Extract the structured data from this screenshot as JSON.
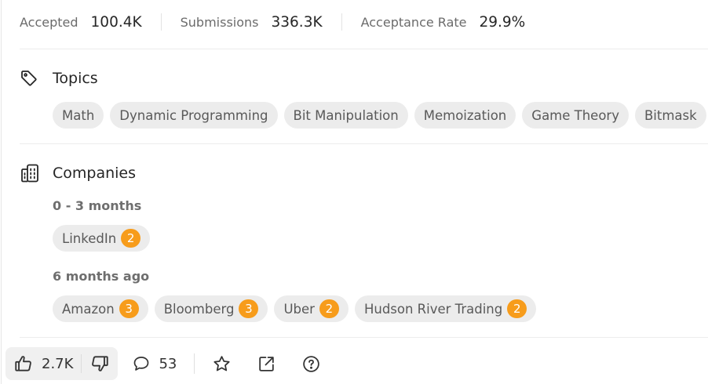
{
  "stats": [
    {
      "label": "Accepted",
      "value": "100.4K"
    },
    {
      "label": "Submissions",
      "value": "336.3K"
    },
    {
      "label": "Acceptance Rate",
      "value": "29.9%"
    }
  ],
  "topics": {
    "title": "Topics",
    "tags": [
      "Math",
      "Dynamic Programming",
      "Bit Manipulation",
      "Memoization",
      "Game Theory",
      "Bitmask"
    ]
  },
  "companies": {
    "title": "Companies",
    "groups": [
      {
        "period": "0 - 3 months",
        "items": [
          {
            "name": "LinkedIn",
            "count": "2"
          }
        ]
      },
      {
        "period": "6 months ago",
        "items": [
          {
            "name": "Amazon",
            "count": "3"
          },
          {
            "name": "Bloomberg",
            "count": "3"
          },
          {
            "name": "Uber",
            "count": "2"
          },
          {
            "name": "Hudson River Trading",
            "count": "2"
          }
        ]
      }
    ]
  },
  "actions": {
    "likes": "2.7K",
    "comments": "53"
  },
  "colors": {
    "count_badge": "#f79c1b",
    "chip_bg": "#ececec"
  }
}
